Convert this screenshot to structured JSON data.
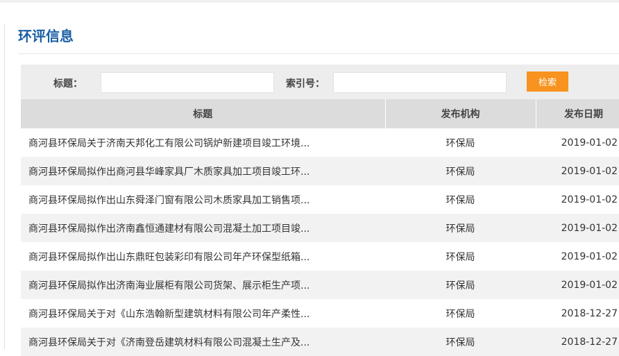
{
  "page": {
    "title": "环评信息"
  },
  "search": {
    "title_label": "标题：",
    "title_value": "",
    "index_label": "索引号：",
    "index_value": "",
    "button_label": "检索"
  },
  "table": {
    "headers": {
      "title": "标题",
      "org": "发布机构",
      "date": "发布日期"
    },
    "rows": [
      {
        "title": "商河县环保局关于济南天邦化工有限公司锅炉新建项目竣工环境...",
        "org": "环保局",
        "date": "2019-01-02"
      },
      {
        "title": "商河县环保局拟作出商河县华峰家具厂木质家具加工项目竣工环...",
        "org": "环保局",
        "date": "2019-01-02"
      },
      {
        "title": "商河县环保局拟作出山东舜泽门窗有限公司木质家具加工销售项...",
        "org": "环保局",
        "date": "2019-01-02"
      },
      {
        "title": "商河县环保局拟作出济南鑫恒通建材有限公司混凝土加工项目竣...",
        "org": "环保局",
        "date": "2019-01-02"
      },
      {
        "title": "商河县环保局拟作出山东鼎旺包装彩印有限公司年产环保型纸箱...",
        "org": "环保局",
        "date": "2019-01-02"
      },
      {
        "title": "商河县环保局拟作出济南海业展柜有限公司货架、展示柜生产项...",
        "org": "环保局",
        "date": "2019-01-02"
      },
      {
        "title": "商河县环保局关于对《山东浩翰新型建筑材料有限公司年产柔性...",
        "org": "环保局",
        "date": "2018-12-27"
      },
      {
        "title": "商河县环保局关于对《济南登岳建筑材料有限公司混凝土生产及...",
        "org": "环保局",
        "date": "2018-12-27"
      }
    ]
  },
  "colors": {
    "title_blue": "#1a5fa6",
    "button_orange": "#f7931e",
    "header_gray": "#dcdcdc",
    "stripe_gray": "#f2f2f2"
  }
}
